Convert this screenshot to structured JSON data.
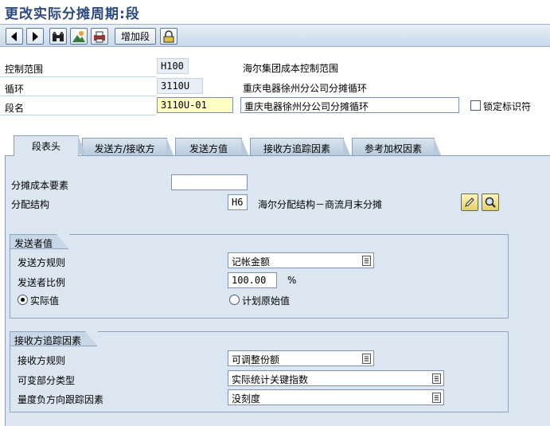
{
  "window": {
    "title": "更改实际分摊周期:段"
  },
  "toolbar": {
    "add_segment_label": "增加段"
  },
  "header": {
    "controlling_area": {
      "label": "控制范围",
      "value": "H100",
      "description": "海尔集团成本控制范围"
    },
    "cycle": {
      "label": "循环",
      "value": "3110U",
      "description": "重庆电器徐州分公司分摊循环"
    },
    "segment": {
      "label": "段名",
      "value": "3110U-01",
      "description": "重庆电器徐州分公司分摊循环"
    },
    "lock_indicator": {
      "label": "锁定标识符",
      "checked": false
    }
  },
  "tabs": [
    {
      "label": "段表头",
      "active": true
    },
    {
      "label": "发送方/接收方",
      "active": false
    },
    {
      "label": "发送方值",
      "active": false
    },
    {
      "label": "接收方追踪因素",
      "active": false
    },
    {
      "label": "参考加权因素",
      "active": false
    }
  ],
  "segment_header": {
    "cost_element": {
      "label": "分摊成本要素",
      "value": ""
    },
    "allocation_structure": {
      "label": "分配结构",
      "value": "H6",
      "description": "海尔分配结构－商流月末分摊"
    }
  },
  "sender_values": {
    "title": "发送者值",
    "sender_rule": {
      "label": "发送方规则",
      "value": "记帐金额"
    },
    "sender_share": {
      "label": "发送者比例",
      "value": "100.00",
      "unit": "%"
    },
    "actual_values": {
      "label": "实际值",
      "selected": true
    },
    "plan_values": {
      "label": "计划原始值",
      "selected": false
    }
  },
  "receiver_tracing": {
    "title": "接收方追踪因素",
    "receiver_rule": {
      "label": "接收方规则",
      "value": "可调整份额"
    },
    "variable_portion_type": {
      "label": "可变部分类型",
      "value": "实际统计关键指数"
    },
    "scale_negative": {
      "label": "量度负方向跟踪因素",
      "value": "没刻度"
    }
  },
  "colors": {
    "title": "#2d4a7e",
    "panel": "#dbe6f1",
    "required_field": "#ffffc4"
  }
}
